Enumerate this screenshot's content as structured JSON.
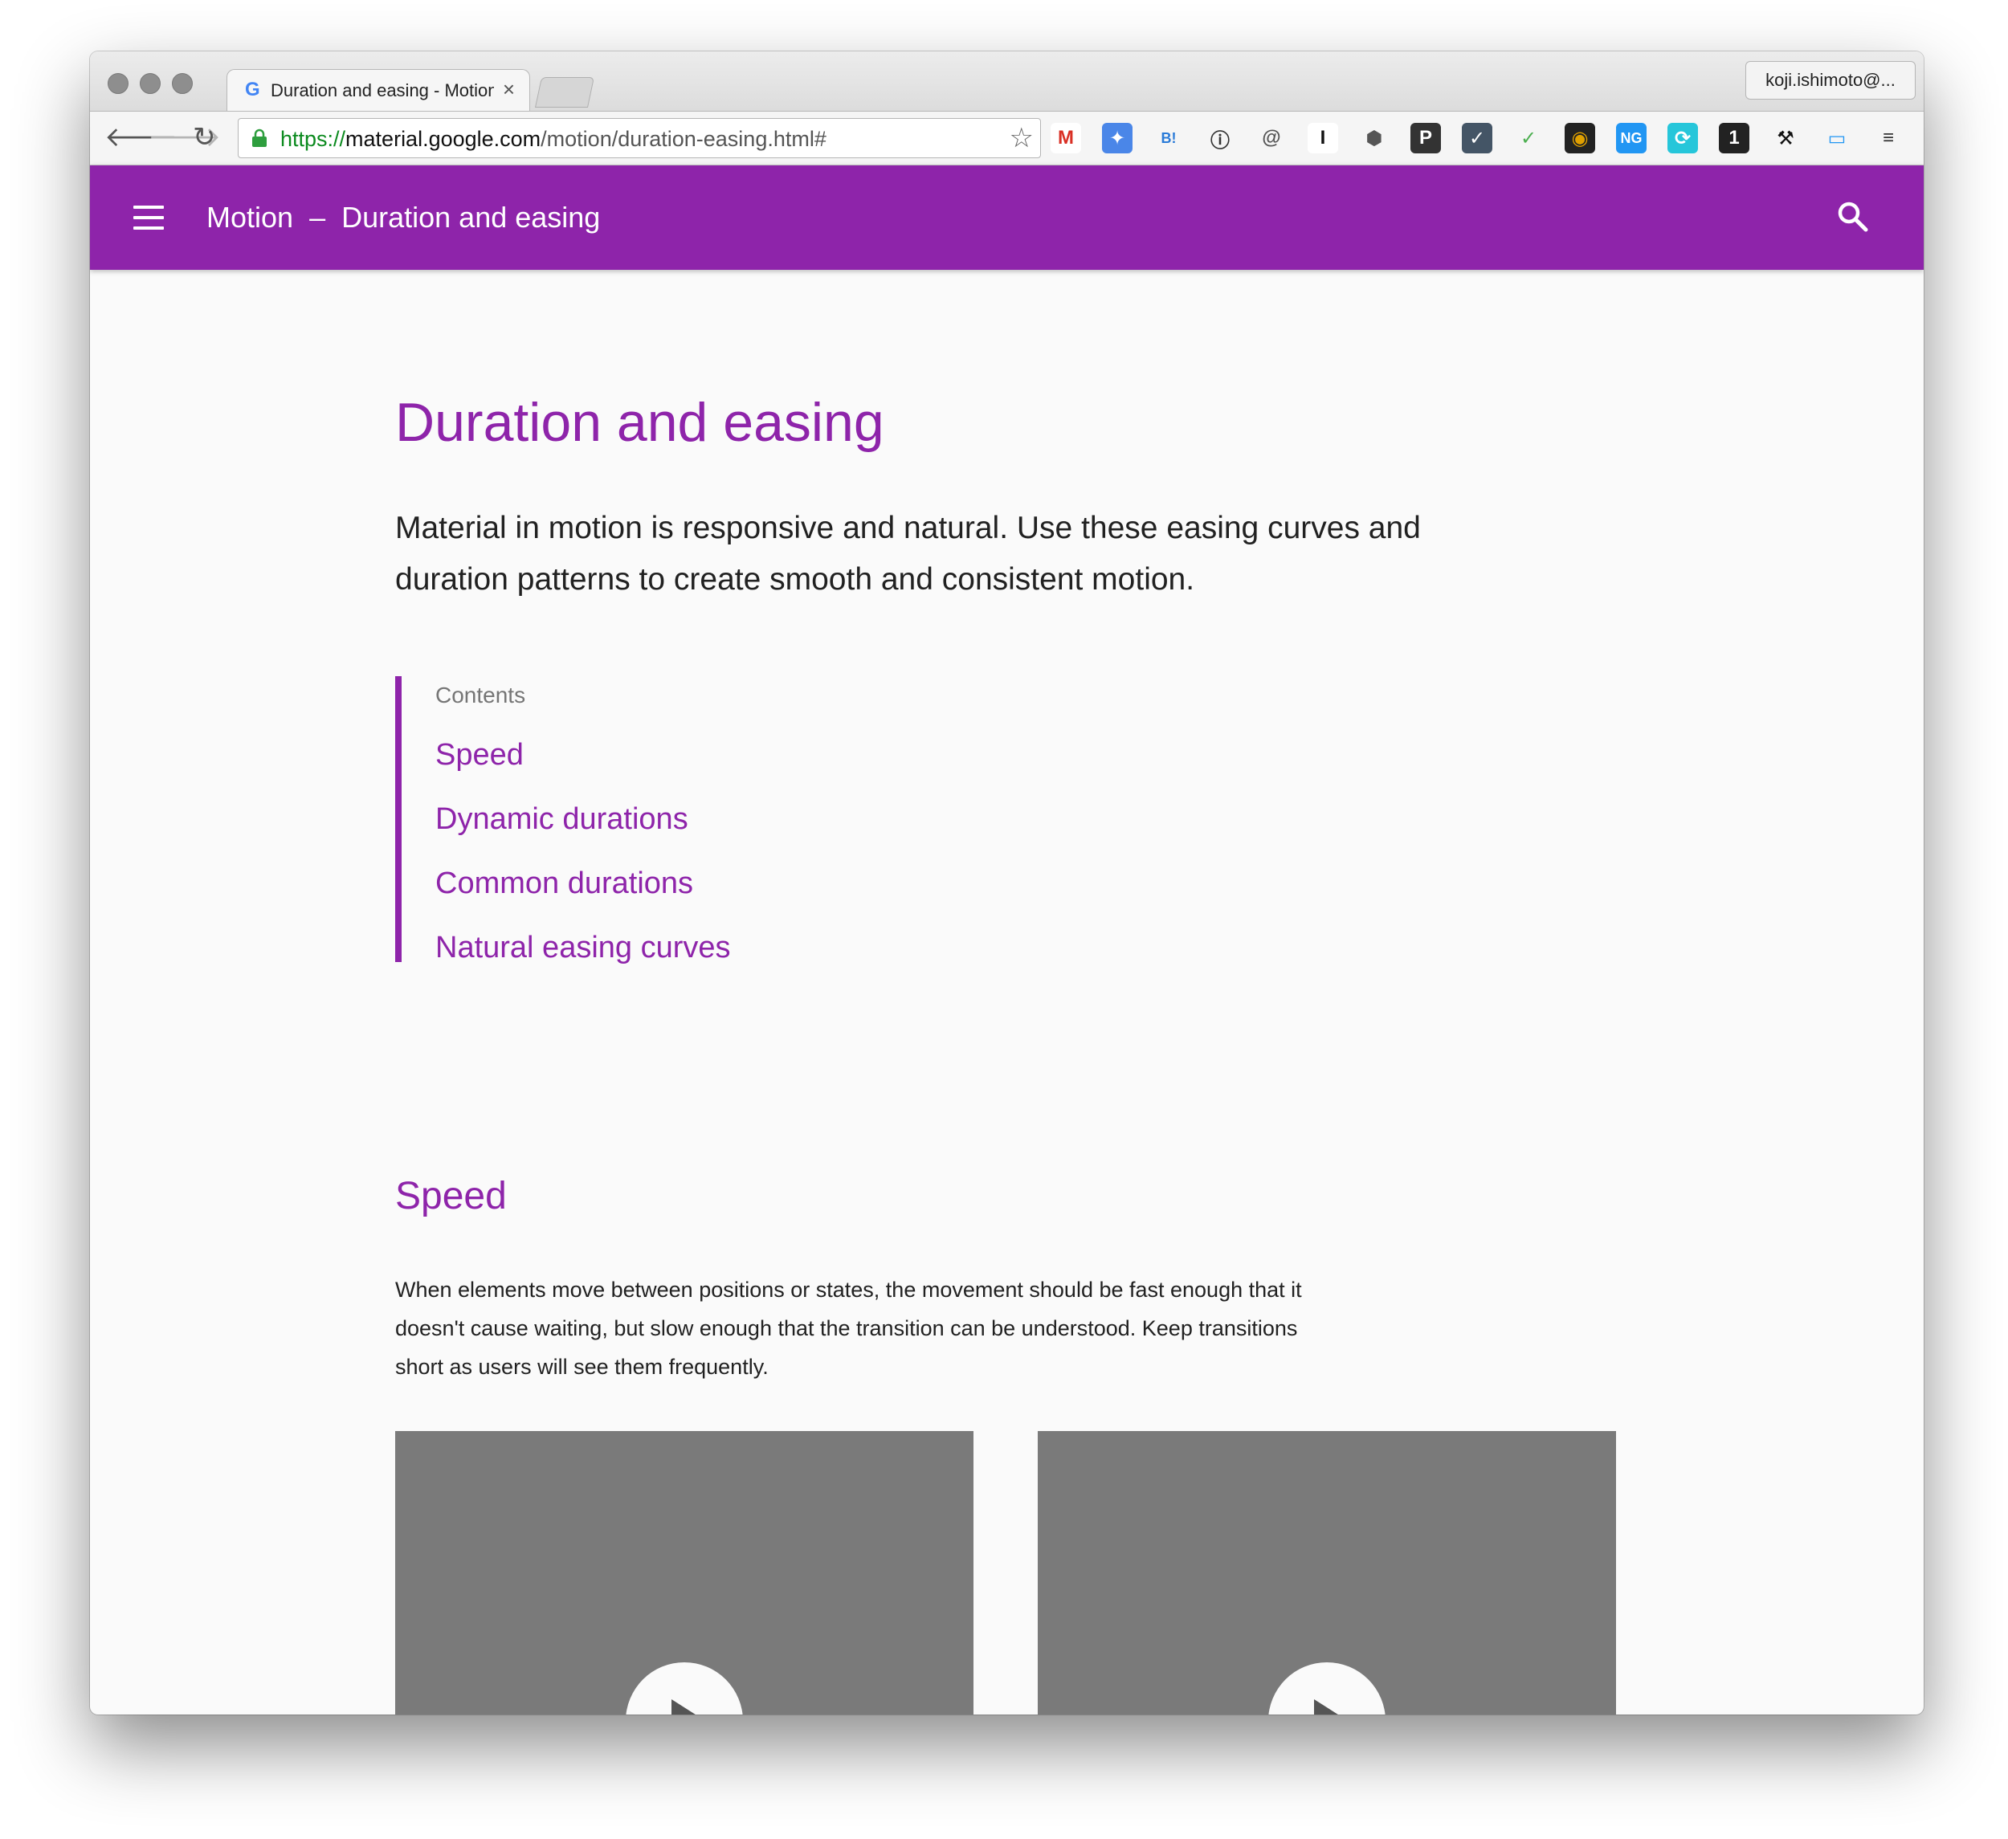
{
  "browser": {
    "tab_title": "Duration and easing - Motion",
    "profile_name": "koji.ishimoto@...",
    "url_scheme": "https://",
    "url_host": "material.google.com",
    "url_path": "/motion/duration-easing.html#",
    "extensions": [
      {
        "name": "gmail-extension-icon",
        "glyph": "M",
        "bg": "#ffffff",
        "fg": "#d93025"
      },
      {
        "name": "pin-extension-icon",
        "glyph": "✦",
        "bg": "#4a86e8",
        "fg": "#ffffff"
      },
      {
        "name": "hatena-bookmark-icon",
        "glyph": "B!",
        "bg": "#f5f5f5",
        "fg": "#2a7bd8"
      },
      {
        "name": "onepassword-extension-icon",
        "glyph": "ⓘ",
        "bg": "#f5f5f5",
        "fg": "#333333"
      },
      {
        "name": "mail-extension-icon",
        "glyph": "@",
        "bg": "#f5f5f5",
        "fg": "#555555"
      },
      {
        "name": "instapaper-extension-icon",
        "glyph": "I",
        "bg": "#ffffff",
        "fg": "#111111"
      },
      {
        "name": "hexagon-extension-icon",
        "glyph": "⬢",
        "bg": "#f5f5f5",
        "fg": "#555555"
      },
      {
        "name": "pocket-extension-icon",
        "glyph": "P",
        "bg": "#333333",
        "fg": "#ffffff"
      },
      {
        "name": "chart-extension-icon",
        "glyph": "✓",
        "bg": "#445566",
        "fg": "#ffffff"
      },
      {
        "name": "trend-extension-icon",
        "glyph": "✓",
        "bg": "#f5f5f5",
        "fg": "#4caf50"
      },
      {
        "name": "color-picker-extension-icon",
        "glyph": "◉",
        "bg": "#222222",
        "fg": "#e0a000"
      },
      {
        "name": "ng-extension-icon",
        "glyph": "NG",
        "bg": "#2196f3",
        "fg": "#ffffff"
      },
      {
        "name": "sync-extension-icon",
        "glyph": "⟳",
        "bg": "#26c6da",
        "fg": "#ffffff"
      },
      {
        "name": "one-extension-icon",
        "glyph": "1",
        "bg": "#222222",
        "fg": "#ffffff"
      },
      {
        "name": "hammer-extension-icon",
        "glyph": "⚒",
        "bg": "#f5f5f5",
        "fg": "#111111"
      },
      {
        "name": "screenshot-extension-icon",
        "glyph": "▭",
        "bg": "#f5f5f5",
        "fg": "#2196f3"
      },
      {
        "name": "menu-extension-icon",
        "glyph": "≡",
        "bg": "#f5f5f5",
        "fg": "#333333"
      }
    ]
  },
  "appbar": {
    "section": "Motion",
    "separator": "–",
    "page": "Duration and easing",
    "color": "#8e24aa"
  },
  "page": {
    "title": "Duration and easing",
    "lead": "Material in motion is responsive and natural. Use these easing curves and duration patterns to create smooth and consistent motion.",
    "contents_label": "Contents",
    "toc": [
      "Speed",
      "Dynamic durations",
      "Common durations",
      "Natural easing curves"
    ],
    "section_title": "Speed",
    "section_body": "When elements move between positions or states, the movement should be fast enough that it doesn't cause waiting, but slow enough that the transition can be understood. Keep transitions short as users will see them frequently."
  }
}
